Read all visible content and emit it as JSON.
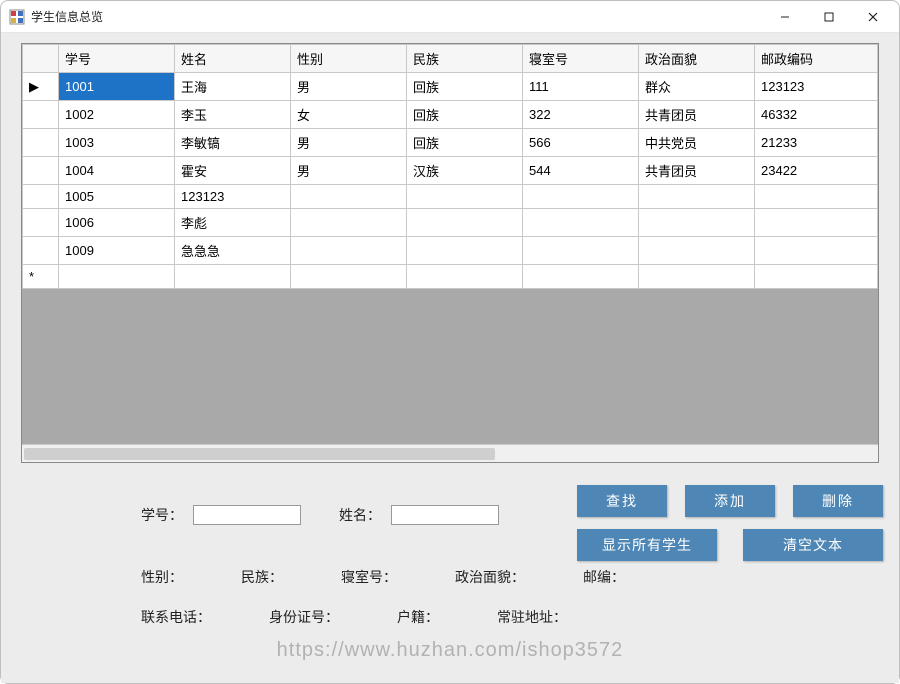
{
  "window": {
    "title": "学生信息总览"
  },
  "grid": {
    "headers": [
      "学号",
      "姓名",
      "性别",
      "民族",
      "寝室号",
      "政治面貌",
      "邮政编码"
    ],
    "rows": [
      {
        "marker": "▶",
        "selected": true,
        "cells": [
          "1001",
          "王海",
          "男",
          "回族",
          "111",
          "群众",
          "123123"
        ]
      },
      {
        "marker": "",
        "selected": false,
        "cells": [
          "1002",
          "李玉",
          "女",
          "回族",
          "322",
          "共青团员",
          "46332"
        ]
      },
      {
        "marker": "",
        "selected": false,
        "cells": [
          "1003",
          "李敏镐",
          "男",
          "回族",
          "566",
          "中共党员",
          "21233"
        ]
      },
      {
        "marker": "",
        "selected": false,
        "cells": [
          "1004",
          "霍安",
          "男",
          "汉族",
          "544",
          "共青团员",
          "23422"
        ]
      },
      {
        "marker": "",
        "selected": false,
        "cells": [
          "1005",
          "123123",
          "",
          "",
          "",
          "",
          ""
        ]
      },
      {
        "marker": "",
        "selected": false,
        "cells": [
          "1006",
          "李彪",
          "",
          "",
          "",
          "",
          ""
        ]
      },
      {
        "marker": "",
        "selected": false,
        "cells": [
          "1009",
          "急急急",
          "",
          "",
          "",
          "",
          ""
        ]
      },
      {
        "marker": "*",
        "selected": false,
        "cells": [
          "",
          "",
          "",
          "",
          "",
          "",
          ""
        ]
      }
    ]
  },
  "buttons": {
    "search": "查找",
    "add": "添加",
    "delete": "删除",
    "show_all": "显示所有学生",
    "clear_text": "清空文本"
  },
  "search": {
    "sno_label": "学号：",
    "sno_value": "",
    "name_label": "姓名：",
    "name_value": ""
  },
  "info_labels_row1": {
    "gender": "性别：",
    "ethnic": "民族：",
    "dorm": "寝室号：",
    "politics": "政治面貌：",
    "postcode": "邮编："
  },
  "info_labels_row2": {
    "phone": "联系电话：",
    "idcard": "身份证号：",
    "huji": "户籍：",
    "address": "常驻地址："
  },
  "watermark": "https://www.huzhan.com/ishop3572"
}
